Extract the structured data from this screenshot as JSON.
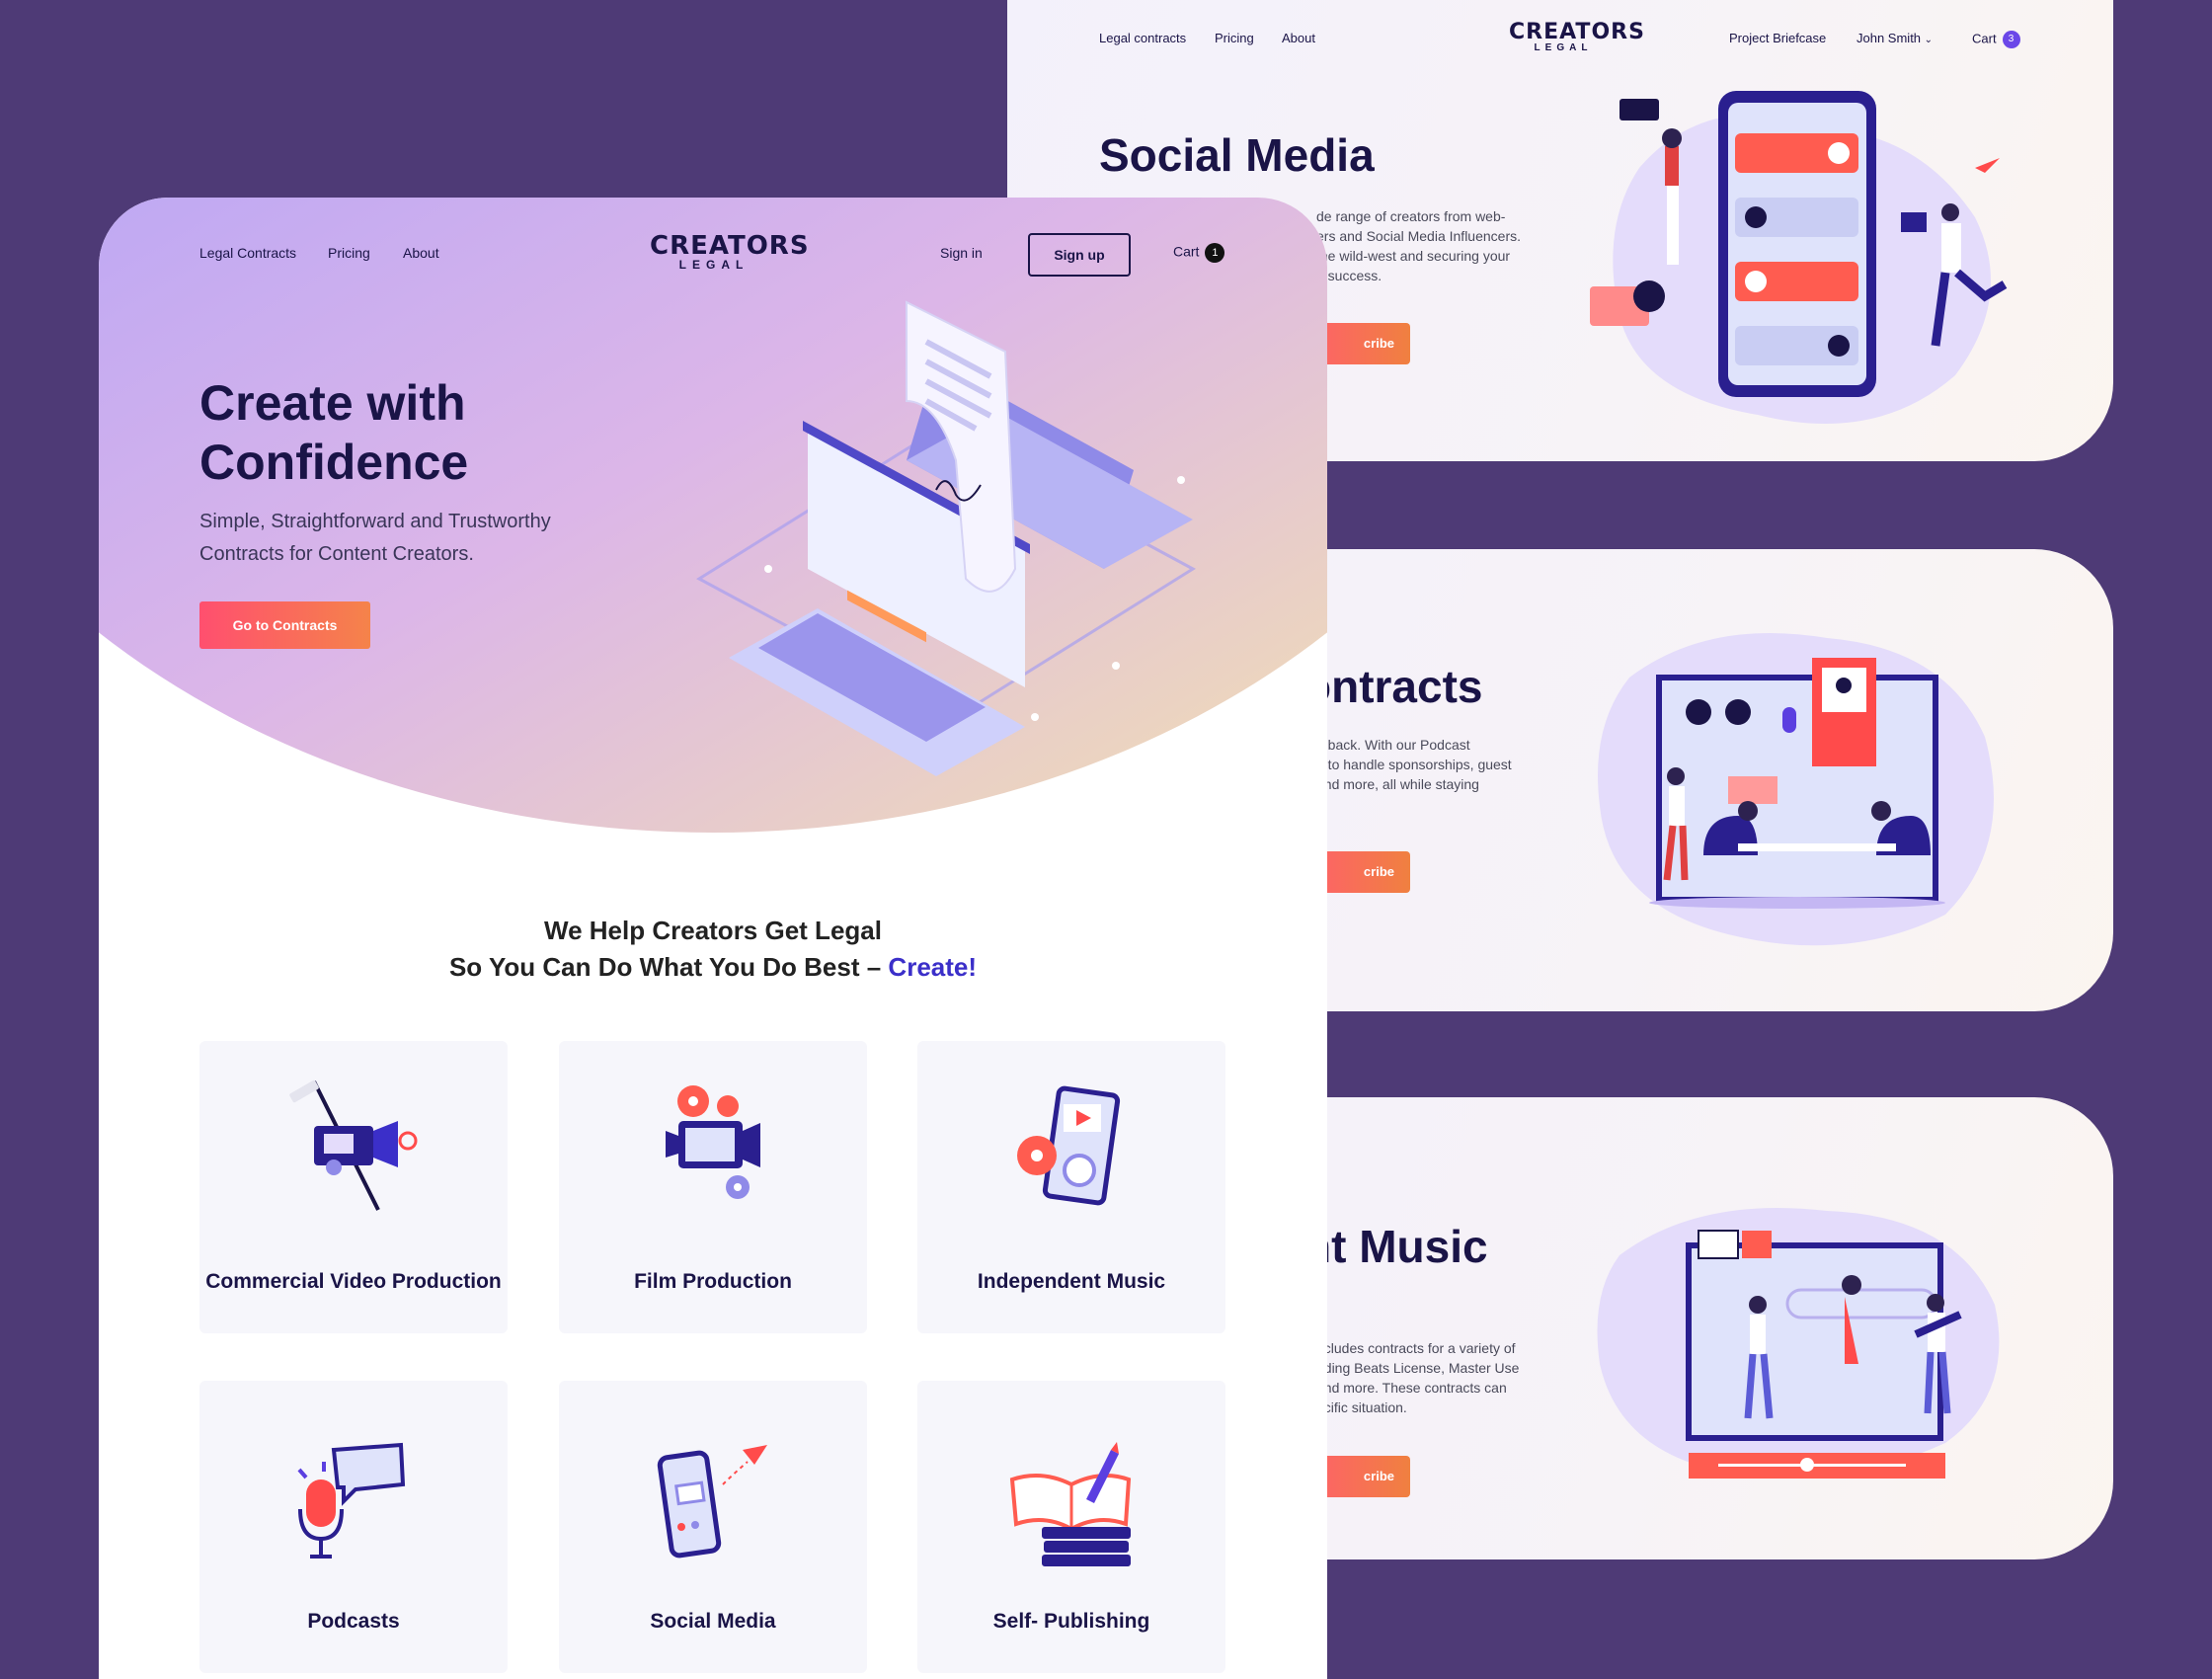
{
  "back_panels": {
    "social": {
      "nav_left": [
        "Legal contracts",
        "Pricing",
        "About"
      ],
      "logo_line1": "CREATORS",
      "logo_line2": "LEGAL",
      "nav_right": {
        "briefcase": "Project Briefcase",
        "user": "John Smith",
        "cart": "Cart",
        "cart_count": "3"
      },
      "title": "Social Media",
      "description": "de range of creators from web-\ners and Social Media Influencers.\nthe wild-west and securing your\nn success.",
      "button": "cribe"
    },
    "podcast": {
      "title": "ontracts",
      "description": "u back. With our Podcast\nd to handle sponsorships, guest\nand more, all while staying",
      "button": "cribe"
    },
    "music": {
      "title": "nt Music",
      "description": "ncludes contracts for a variety of\nuding Beats License, Master Use\nand more. These contracts can\necific situation.",
      "button": "cribe"
    }
  },
  "main": {
    "nav_left": [
      "Legal Contracts",
      "Pricing",
      "About"
    ],
    "logo_line1": "CREATORS",
    "logo_line2": "LEGAL",
    "sign_in": "Sign in",
    "sign_up": "Sign up",
    "cart": "Cart",
    "cart_count": "1",
    "hero_title": "Create with Confidence",
    "hero_subtitle": "Simple, Straightforward and Trustworthy Contracts for Content Creators.",
    "cta": "Go to Contracts",
    "section_line1": "We Help Creators Get Legal",
    "section_line2": "So You Can Do What You Do Best –",
    "section_highlight": "Create!",
    "cards": [
      {
        "label": "Commercial Video Production",
        "icon": "video-camera-icon"
      },
      {
        "label": "Film Production",
        "icon": "film-projector-icon"
      },
      {
        "label": "Independent Music",
        "icon": "music-player-icon"
      },
      {
        "label": "Podcasts",
        "icon": "microphone-icon"
      },
      {
        "label": "Social Media",
        "icon": "smartphone-icon"
      },
      {
        "label": "Self- Publishing",
        "icon": "books-icon"
      }
    ]
  },
  "colors": {
    "background": "#4e3a76",
    "navy": "#1a1447",
    "accent": "#3b2fc9",
    "cta_start": "#ff4f6f",
    "cta_end": "#f5834a"
  }
}
